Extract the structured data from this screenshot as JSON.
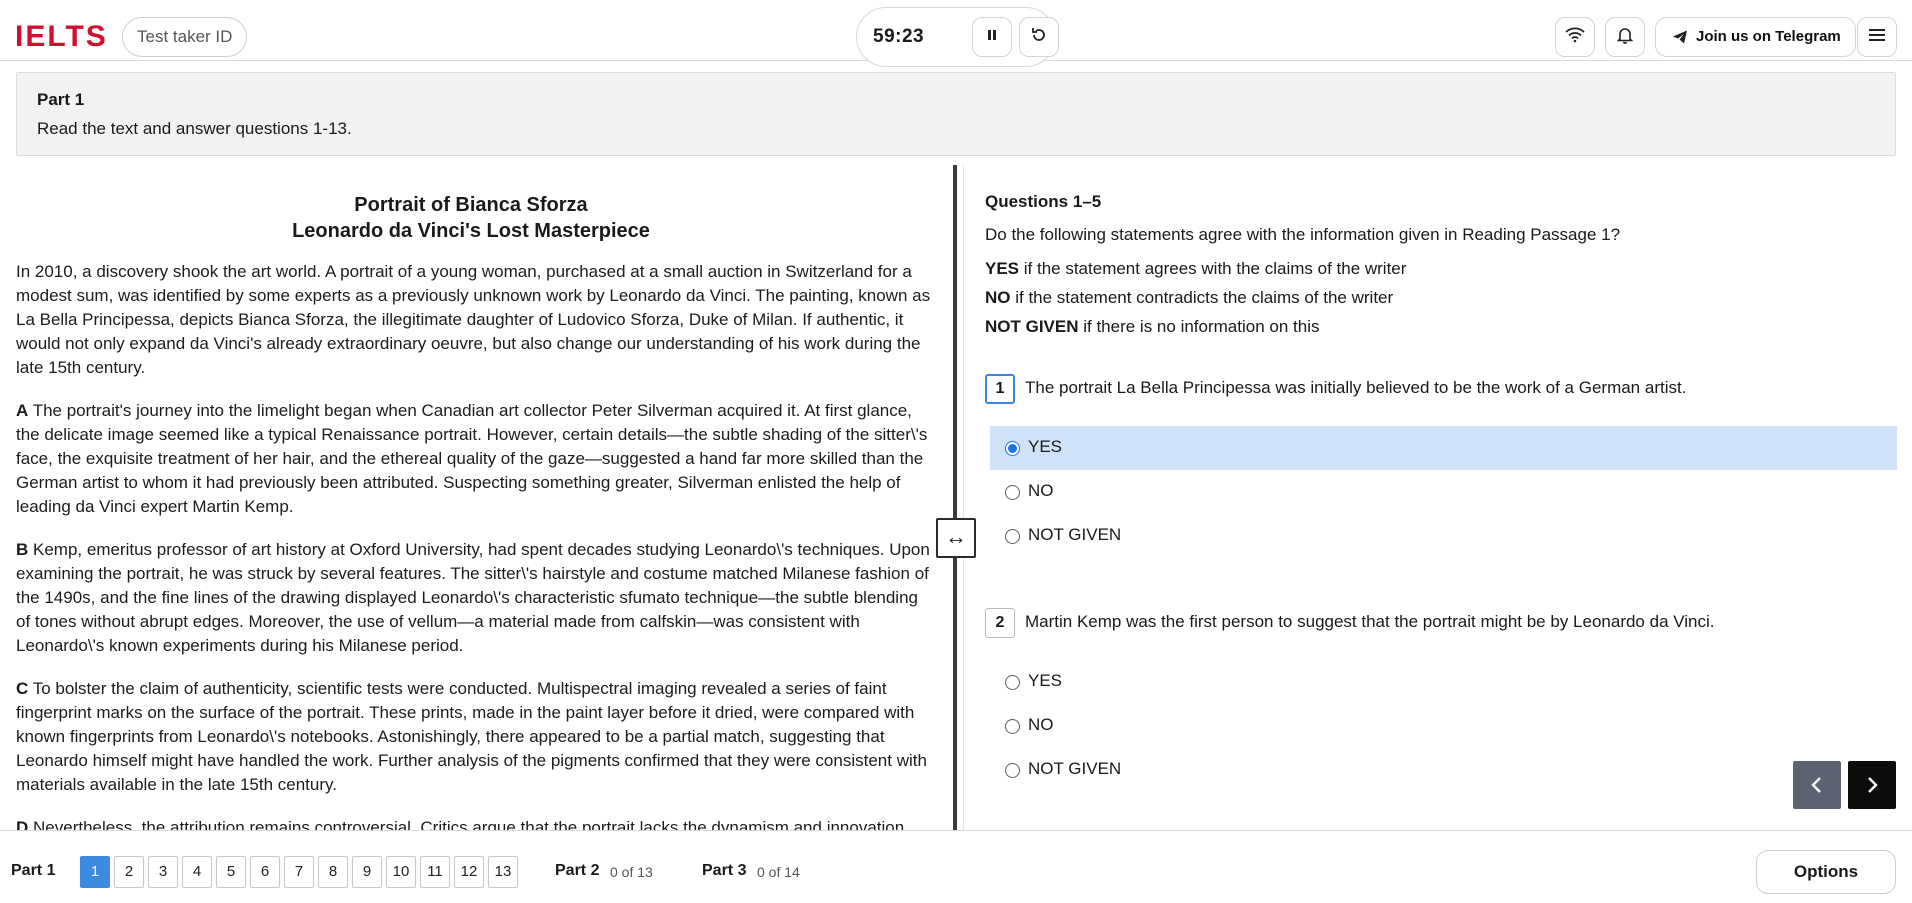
{
  "header": {
    "logo": "IELTS",
    "test_taker_id": "Test taker ID",
    "timer": "59:23",
    "telegram_label": "Join us on Telegram"
  },
  "part_banner": {
    "title": "Part 1",
    "instruction": "Read the text and answer questions 1-13."
  },
  "passage": {
    "title_line1": "Portrait of Bianca Sforza",
    "title_line2": "Leonardo da Vinci's Lost Masterpiece",
    "paragraphs": [
      {
        "letter": "",
        "text": "In 2010, a discovery shook the art world. A portrait of a young woman, purchased at a small auction in Switzerland for a modest sum, was identified by some experts as a previously unknown work by Leonardo da Vinci. The painting, known as La Bella Principessa, depicts Bianca Sforza, the illegitimate daughter of Ludovico Sforza, Duke of Milan. If authentic, it would not only expand da Vinci's already extraordinary oeuvre, but also change our understanding of his work during the late 15th century."
      },
      {
        "letter": "A",
        "text": " The portrait's journey into the limelight began when Canadian art collector Peter Silverman acquired it. At first glance, the delicate image seemed like a typical Renaissance portrait. However, certain details—the subtle shading of the sitter\\'s face, the exquisite treatment of her hair, and the ethereal quality of the gaze—suggested a hand far more skilled than the German artist to whom it had previously been attributed. Suspecting something greater, Silverman enlisted the help of leading da Vinci expert Martin Kemp."
      },
      {
        "letter": "B",
        "text": " Kemp, emeritus professor of art history at Oxford University, had spent decades studying Leonardo\\'s techniques. Upon examining the portrait, he was struck by several features. The sitter\\'s hairstyle and costume matched Milanese fashion of the 1490s, and the fine lines of the drawing displayed Leonardo\\'s characteristic sfumato technique—the subtle blending of tones without abrupt edges. Moreover, the use of vellum—a material made from calfskin—was consistent with Leonardo\\'s known experiments during his Milanese period."
      },
      {
        "letter": "C",
        "text": " To bolster the claim of authenticity, scientific tests were conducted. Multispectral imaging revealed a series of faint fingerprint marks on the surface of the portrait. These prints, made in the paint layer before it dried, were compared with known fingerprints from Leonardo\\'s notebooks. Astonishingly, there appeared to be a partial match, suggesting that Leonardo himself might have handled the work. Further analysis of the pigments confirmed that they were consistent with materials available in the late 15th century."
      },
      {
        "letter": "D",
        "text": " Nevertheless, the attribution remains controversial. Critics argue that the portrait lacks the dynamism and innovation"
      }
    ]
  },
  "questions": {
    "heading": "Questions 1–5",
    "instruction": "Do the following statements agree with the information given in Reading Passage 1?",
    "legend": [
      {
        "key": "YES",
        "desc": " if the statement agrees with the claims of the writer"
      },
      {
        "key": "NO",
        "desc": " if the statement contradicts the claims of the writer"
      },
      {
        "key": "NOT GIVEN",
        "desc": " if there is no information on this"
      }
    ],
    "items": [
      {
        "number": "1",
        "text": "The portrait La Bella Principessa was initially believed to be the work of a German artist.",
        "options": [
          "YES",
          "NO",
          "NOT GIVEN"
        ],
        "selected": "YES"
      },
      {
        "number": "2",
        "text": "Martin Kemp was the first person to suggest that the portrait might be by Leonardo da Vinci.",
        "options": [
          "YES",
          "NO",
          "NOT GIVEN"
        ],
        "selected": ""
      }
    ]
  },
  "footer": {
    "part1_label": "Part 1",
    "question_numbers": [
      "1",
      "2",
      "3",
      "4",
      "5",
      "6",
      "7",
      "8",
      "9",
      "10",
      "11",
      "12",
      "13"
    ],
    "current_question": "1",
    "part2_label": "Part 2",
    "part2_count": "0 of 13",
    "part3_label": "Part 3",
    "part3_count": "0 of 14",
    "options_label": "Options"
  },
  "colors": {
    "brand": "#d0102e",
    "accent": "#3d8be0",
    "selected_row": "#cfe2f8"
  },
  "icons": {
    "wifi": "wifi-icon",
    "bell": "bell-icon",
    "menu": "menu-icon",
    "pause": "pause-icon",
    "reset": "reset-icon",
    "telegram": "telegram-icon",
    "resize": "resize-icon"
  }
}
